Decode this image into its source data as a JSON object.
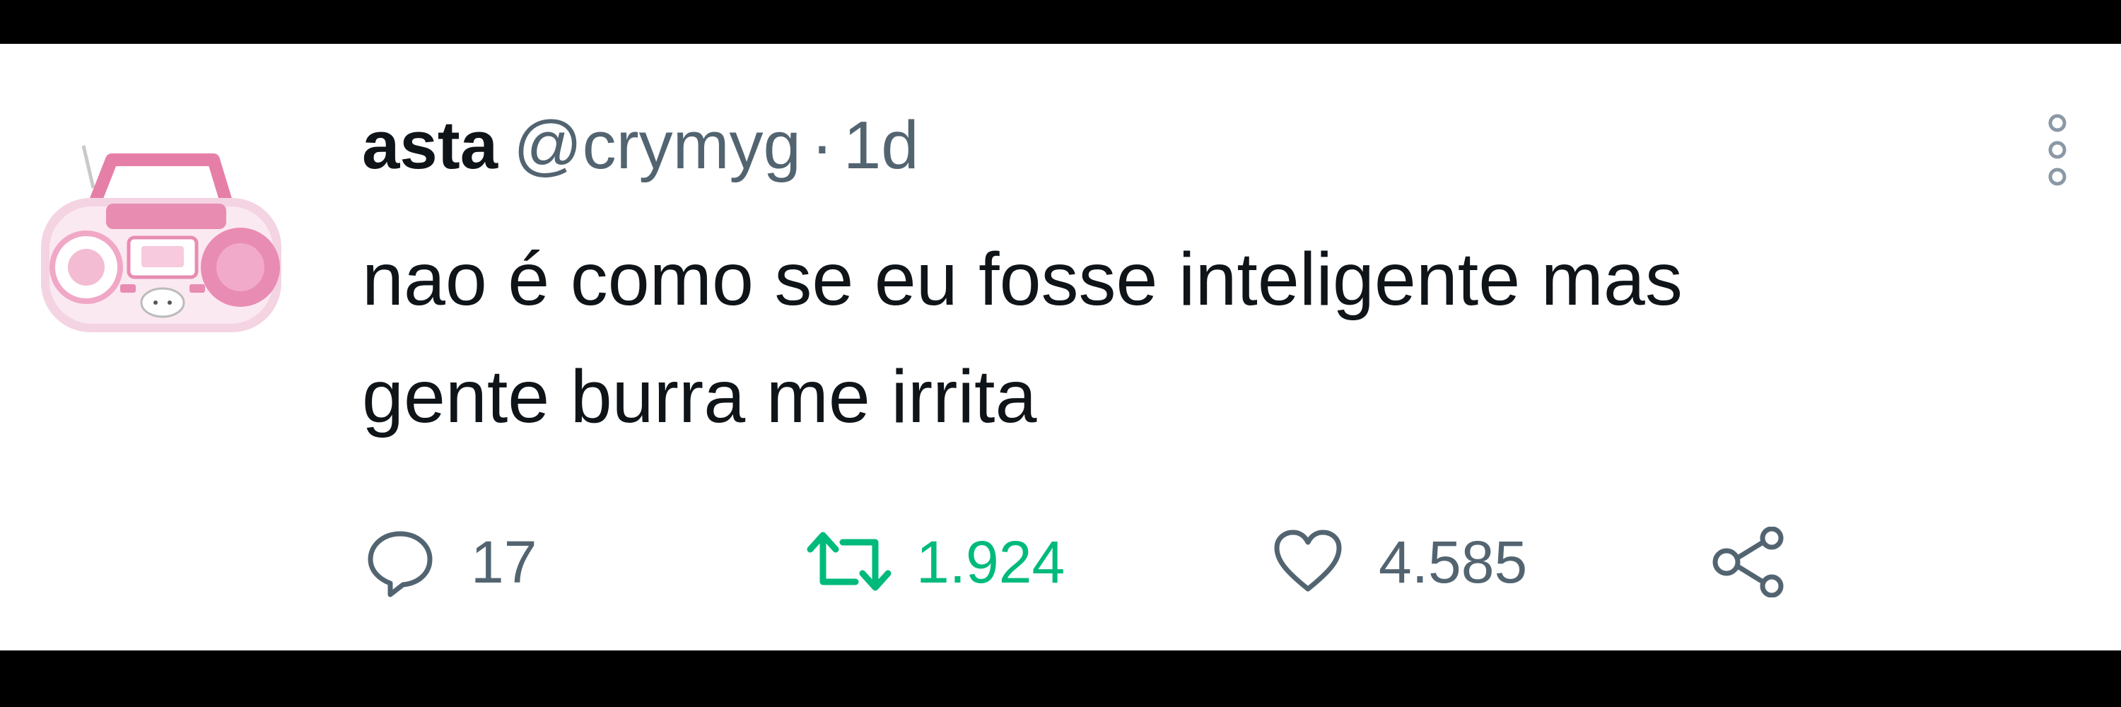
{
  "tweet": {
    "author_name": "asta",
    "handle": "@crymyg",
    "separator": "·",
    "time": "1d",
    "text_line_1": "nao é como se eu fosse inteligente mas",
    "text_line_2": "gente burra me irrita",
    "avatar_icon": "pink-boombox-avatar"
  },
  "actions": {
    "reply": {
      "icon": "speech-bubble-icon",
      "count": "17"
    },
    "retweet": {
      "icon": "retweet-icon",
      "count": "1.924",
      "color": "#00ba7c"
    },
    "like": {
      "icon": "heart-icon",
      "count": "4.585"
    },
    "share": {
      "icon": "share-icon"
    }
  },
  "colors": {
    "background": "#ffffff",
    "frame": "#000000",
    "text_primary": "#0f1419",
    "text_secondary": "#536471",
    "retweet_active": "#00ba7c"
  }
}
